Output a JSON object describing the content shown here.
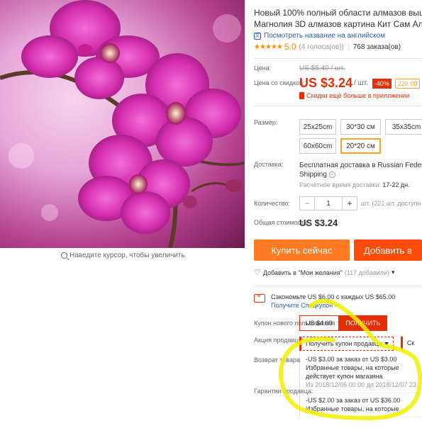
{
  "product": {
    "title_line1": "Новый 100% полный области алмазов выш",
    "title_line2": "Магнолия 3D алмазов картина Кит Сам Алм",
    "translate_link": "Посмотреть название на английском",
    "translate_icon": "translate-icon",
    "stars": "★★★★★",
    "rating": "5.0",
    "votes": "(4 голоса(ов))",
    "orders": "768 заказа(ов)"
  },
  "image": {
    "zoom_hint": "Наведите курсор, чтобы увеличить"
  },
  "price": {
    "label": "Цена:",
    "old_price": "US $5.40 / шт.",
    "sale_label": "Цена со скидкой:",
    "sale_price": "US $3.24",
    "per_unit": "/ шт.",
    "discount": "-40%",
    "timer": "22h:08",
    "app_discount": "Скидки ещё больше в приложении"
  },
  "size": {
    "label": "Размер:",
    "options": [
      "25x25cm",
      "30*30 см",
      "35x35cm",
      "60x60cm",
      "20*20 см"
    ],
    "selected": "20*20 см"
  },
  "shipping": {
    "label": "Доставка:",
    "line1": "Бесплатная доставка в Russian Feder",
    "line2": "Shipping",
    "time_label": "Расчётное время доставки:",
    "time_value": "17-22 дн."
  },
  "quantity": {
    "label": "Количество:",
    "minus": "−",
    "value": "1",
    "plus": "+",
    "note": "шт. (221 шт. доступн"
  },
  "total": {
    "label": "Общая стоимость:",
    "value": "US $3.24"
  },
  "buttons": {
    "buy_now": "Купить сейчас",
    "add_to_cart": "Добавить в"
  },
  "wishlist": {
    "label": "Добавить в \"Мои желания\"",
    "count": "(117 добавили)",
    "caret": "▾"
  },
  "coupons": {
    "save_text": "Сэкономьте US $6.00 с каждых US $65.00",
    "save_link": "Получите Спецкупон >",
    "new_user_label": "Купон нового пользователя :",
    "new_user_value": "US $4.00",
    "new_user_button": "ПОЛУЧИТЬ",
    "promo_label": "Акция продавца:",
    "get_coupon": "Получить купон продавца",
    "get_coupon2": "Ск",
    "return_label": "Возврат товара",
    "guarantee_label": "Гарантии продавца:",
    "items": [
      {
        "line1": "-US $3.00 за заказ от US $3.00",
        "line2": "Избранные товары, на которые",
        "line3": "действует купон магазина",
        "dates": "Из 2018/12/06 00:00 до 2018/12/07 23"
      },
      {
        "line1": "-US $2.00 за заказ от US $36.00",
        "line2": "Избранные товары, на которые",
        "line3": "",
        "dates": ""
      }
    ]
  },
  "colors": {
    "accent": "#e62e04",
    "buy": "#ff7a20",
    "cart": "#ff4b08",
    "link": "#2a5dad",
    "highlight": "#f5f500"
  }
}
